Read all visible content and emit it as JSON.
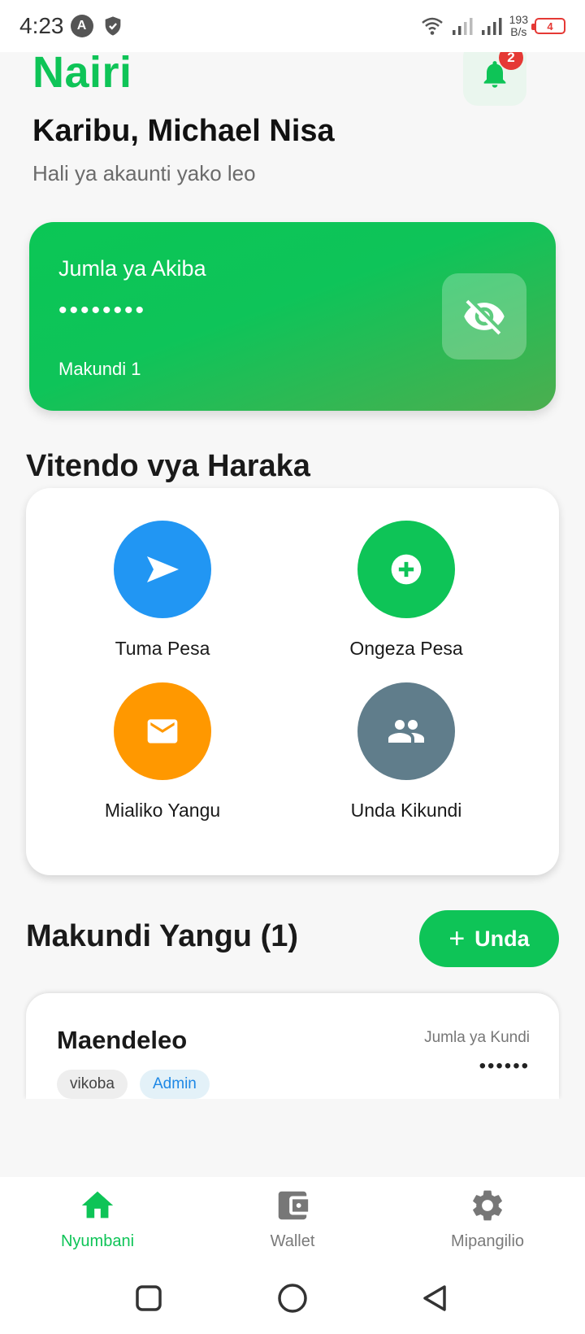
{
  "status_bar": {
    "time": "4:23",
    "app_badge": "A",
    "net_speed_value": "193",
    "net_speed_unit": "B/s",
    "battery": "4"
  },
  "header": {
    "brand": "Nairi",
    "notification_count": "2",
    "greeting": "Karibu, Michael Nisa",
    "subtitle": "Hali ya akaunti yako leo"
  },
  "balance_card": {
    "label": "Jumla ya Akiba",
    "masked_value": "••••••••",
    "groups_text": "Makundi 1",
    "visibility_icon": "eye-off-icon"
  },
  "quick_actions": {
    "title": "Vitendo vya Haraka",
    "items": [
      {
        "label": "Tuma Pesa",
        "icon": "send-icon",
        "color": "#2196F3"
      },
      {
        "label": "Ongeza Pesa",
        "icon": "add-circle-icon",
        "color": "#0EC457"
      },
      {
        "label": "Mialiko Yangu",
        "icon": "mail-icon",
        "color": "#FF9800"
      },
      {
        "label": "Unda Kikundi",
        "icon": "group-icon",
        "color": "#607D8B"
      }
    ]
  },
  "groups": {
    "title": "Makundi Yangu (1)",
    "create_label": "Unda",
    "items": [
      {
        "name": "Maendeleo",
        "type": "vikoba",
        "role": "Admin",
        "total_label": "Jumla ya Kundi",
        "total": "••••••"
      }
    ]
  },
  "bottom_nav": {
    "items": [
      {
        "label": "Nyumbani",
        "icon": "home-icon",
        "active": true
      },
      {
        "label": "Wallet",
        "icon": "wallet-icon",
        "active": false
      },
      {
        "label": "Mipangilio",
        "icon": "gear-icon",
        "active": false
      }
    ]
  },
  "colors": {
    "brand_green": "#0EC457",
    "badge_red": "#E53935",
    "admin_blue": "#1E88E5"
  }
}
